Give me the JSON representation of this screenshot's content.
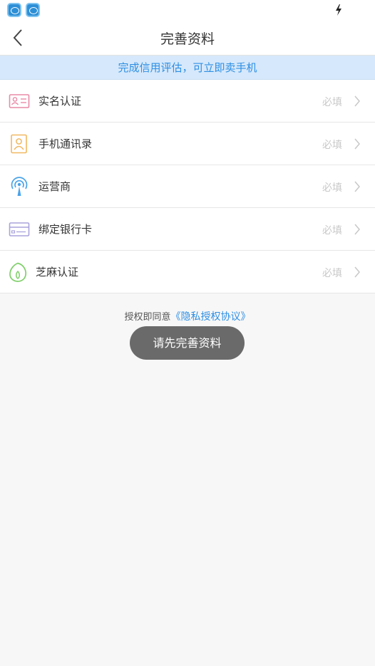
{
  "status_bar": {
    "app_icons": [
      "app-icon",
      "app-icon"
    ],
    "charging_icon": "bolt-icon"
  },
  "header": {
    "back_icon": "chevron-left-icon",
    "title": "完善资料"
  },
  "banner": {
    "text": "完成信用评估，可立即卖手机"
  },
  "items": [
    {
      "icon": "id-card-icon",
      "label": "实名认证",
      "status": "必填",
      "color": "#e98aa6"
    },
    {
      "icon": "contacts-icon",
      "label": "手机通讯录",
      "status": "必填",
      "color": "#f1b860"
    },
    {
      "icon": "signal-tower-icon",
      "label": "运营商",
      "status": "必填",
      "color": "#4aa3e8"
    },
    {
      "icon": "bank-card-icon",
      "label": "绑定银行卡",
      "status": "必填",
      "color": "#a9a3dc"
    },
    {
      "icon": "sesame-icon",
      "label": "芝麻认证",
      "status": "必填",
      "color": "#7fcf6a"
    }
  ],
  "agreement": {
    "prefix": "授权即同意",
    "link": "《隐私授权协议》"
  },
  "toast": {
    "text": "请先完善资料"
  },
  "colors": {
    "accent": "#2e8fe3",
    "banner_bg": "#d6e8fb",
    "toast_bg": "#6a6a6a"
  }
}
